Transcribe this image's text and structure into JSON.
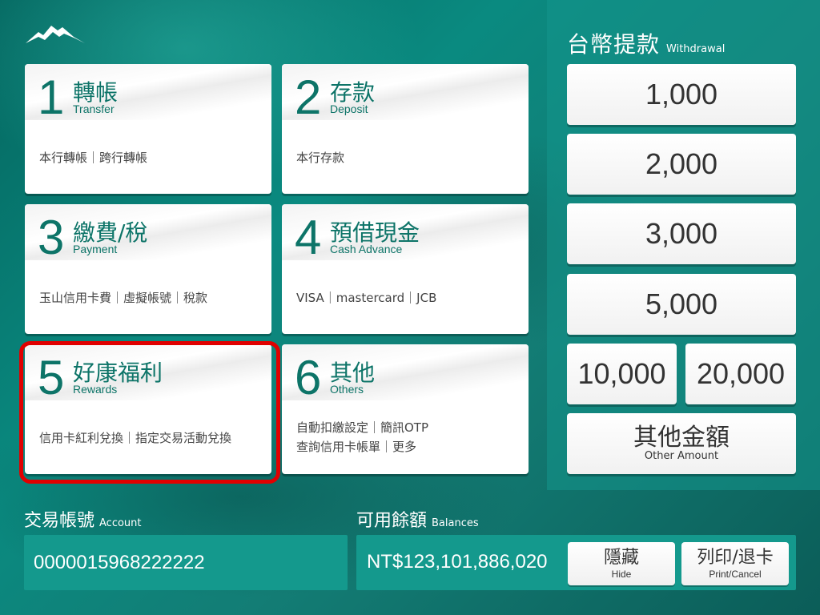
{
  "withdrawal": {
    "title": "台幣提款",
    "title_en": "Withdrawal",
    "amounts": [
      "1,000",
      "2,000",
      "3,000",
      "5,000",
      "10,000",
      "20,000"
    ],
    "other_zh": "其他金額",
    "other_en": "Other Amount"
  },
  "menu": [
    {
      "num": "1",
      "zh": "轉帳",
      "en": "Transfer",
      "desc": "本行轉帳｜跨行轉帳"
    },
    {
      "num": "2",
      "zh": "存款",
      "en": "Deposit",
      "desc": "本行存款"
    },
    {
      "num": "3",
      "zh": "繳費/稅",
      "en": "Payment",
      "desc": "玉山信用卡費｜虛擬帳號｜稅款"
    },
    {
      "num": "4",
      "zh": "預借現金",
      "en": "Cash Advance",
      "desc": "VISA｜mastercard｜JCB"
    },
    {
      "num": "5",
      "zh": "好康福利",
      "en": "Rewards",
      "desc": "信用卡紅利兌換｜指定交易活動兌換"
    },
    {
      "num": "6",
      "zh": "其他",
      "en": "Others",
      "desc_line1": "自動扣繳設定｜簡訊OTP",
      "desc_line2": "查詢信用卡帳單｜更多"
    }
  ],
  "account": {
    "label": "交易帳號",
    "label_en": "Account",
    "value": "0000015968222222"
  },
  "balance": {
    "label": "可用餘額",
    "label_en": "Balances",
    "value": "NT$123,101,886,020"
  },
  "buttons": {
    "hide_zh": "隱藏",
    "hide_en": "Hide",
    "print_zh": "列印/退卡",
    "print_en": "Print/Cancel"
  },
  "colors": {
    "accent": "#0d7468",
    "background": "#0a8a80",
    "highlight": "#e00000"
  }
}
